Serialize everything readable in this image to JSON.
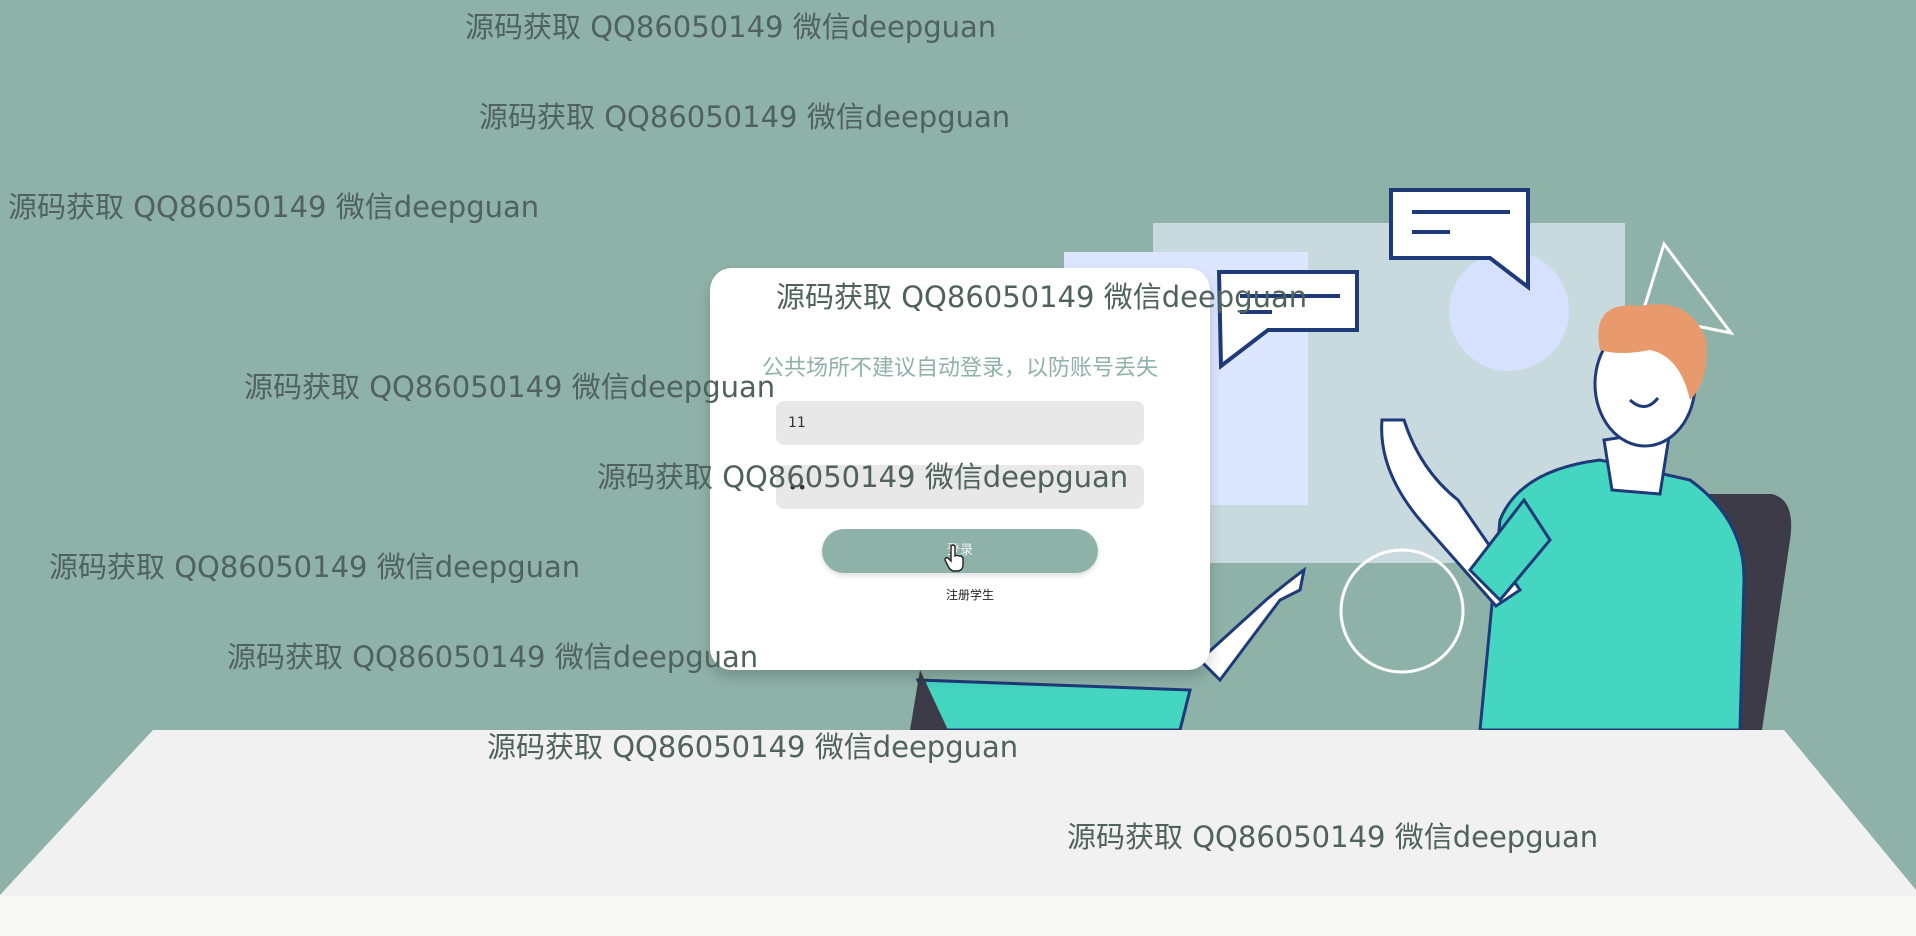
{
  "login": {
    "tip": "公共场所不建议自动登录，以防账号丢失",
    "username_value": "11",
    "password_value": "••",
    "login_label": "登录",
    "register_link": "注册学生"
  },
  "watermark": {
    "text": "源码获取 QQ86050149 微信deepguan"
  },
  "colors": {
    "background": "#8fb2a8",
    "card": "#ffffff",
    "accent": "#8fb2a8",
    "desk": "#f1f1f1",
    "shirt": "#45d6c2",
    "outline": "#1e3a78"
  },
  "icons": {
    "cursor": "hand-pointer-icon"
  }
}
